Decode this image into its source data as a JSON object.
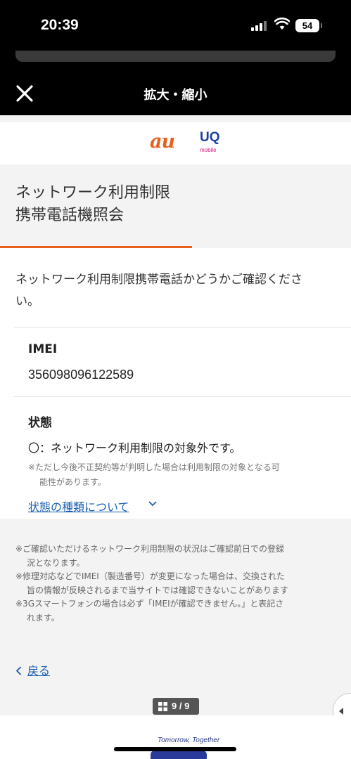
{
  "status_bar": {
    "time": "20:39",
    "battery": "54"
  },
  "top_bar": {
    "title": "拡大・縮小"
  },
  "logos": {
    "au": "au",
    "uq": "UQ",
    "uq_sub": "mobile"
  },
  "page": {
    "title_line1": "ネットワーク利用制限",
    "title_line2": "携帯電話機照会",
    "intro_line1": "ネットワーク利用制限携帯電話かどうかご確認くださ",
    "intro_line2": "い。",
    "imei_label": "IMEI",
    "imei_value": "356098096122589",
    "status_label": "状態",
    "status_value": "〇：ネットワーク利用制限の対象外です。",
    "status_note_line1": "※ただし今後不正契約等が判明した場合は利用制限の対象となる可",
    "status_note_line2": "能性があります。",
    "status_types_link": "状態の種類について",
    "notes": [
      "※ご確認いただけるネットワーク利用制限の状況はご確認前日での登録",
      "況となります。",
      "※修理対応などでIMEI（製造番号）が変更になった場合は、交換された",
      "旨の情報が反映されるまで当サイトでは確認できないことがあります",
      "※3Gスマートフォンの場合は必ず「IMEIが確認できません。」と表記さ",
      "れます。"
    ],
    "back_link": "戻る"
  },
  "pager": {
    "label": "9 / 9"
  },
  "footer": {
    "slogan": "Tomorrow, Together"
  },
  "colors": {
    "accent": "#e8601c",
    "link": "#1a5fb4",
    "uq_blue": "#1e3fa0",
    "uq_pink": "#d6127c"
  }
}
